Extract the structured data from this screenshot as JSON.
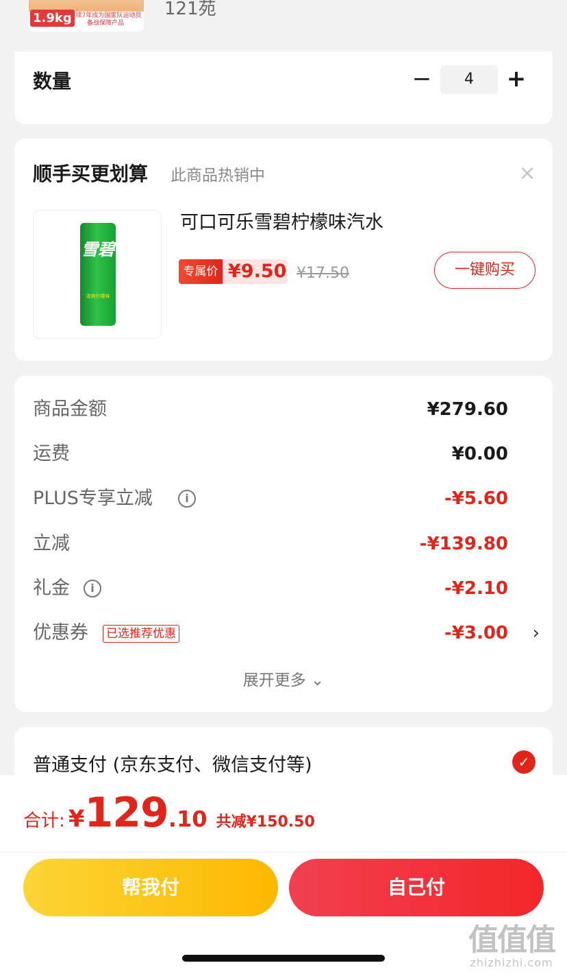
{
  "product_top": {
    "weight_badge": "1.9kg",
    "promo_text": "连续7年成为国家队运动员备战保障产品",
    "sold_count": "121苑"
  },
  "quantity": {
    "label": "数量",
    "minus": "−",
    "value": "4",
    "plus": "+"
  },
  "recommend": {
    "title": "顺手买更划算",
    "subtitle": "此商品热销中",
    "close": "×",
    "product_image_text": "雪碧",
    "product_image_subtext": "清爽柠檬味",
    "product_name": "可口可乐雪碧柠檬味汽水",
    "price_tag_label": "专属价",
    "price": "¥9.50",
    "original_price": "¥17.50",
    "buy_button": "一键购买"
  },
  "summary": {
    "rows": [
      {
        "label": "商品金额",
        "value": "¥279.60"
      },
      {
        "label": "运费",
        "value": "¥0.00"
      },
      {
        "label": "PLUS专享立减",
        "value": "-¥5.60"
      },
      {
        "label": "立减",
        "value": "-¥139.80"
      },
      {
        "label": "礼金",
        "value": "-¥2.10"
      },
      {
        "label": "优惠券",
        "value": "-¥3.00",
        "badge": "已选推荐优惠"
      }
    ],
    "info_icon": "i",
    "chevron": "›",
    "expand_label": "展开更多 ⌄"
  },
  "payment": {
    "label": "普通支付 (京东支付、微信支付等)",
    "check": "✓"
  },
  "footer": {
    "total_label": "合计:",
    "total_currency": "¥",
    "total_int": "129",
    "total_dec": ".10",
    "total_saved": "共减¥150.50",
    "help_pay_button": "帮我付",
    "self_pay_button": "自己付"
  },
  "watermark": {
    "main": "值值值",
    "sub": "zhizhizhi.com"
  },
  "colors": {
    "accent_red": "#e1251b",
    "yellow_button": "#fdb800",
    "red_button": "#f3262a"
  }
}
